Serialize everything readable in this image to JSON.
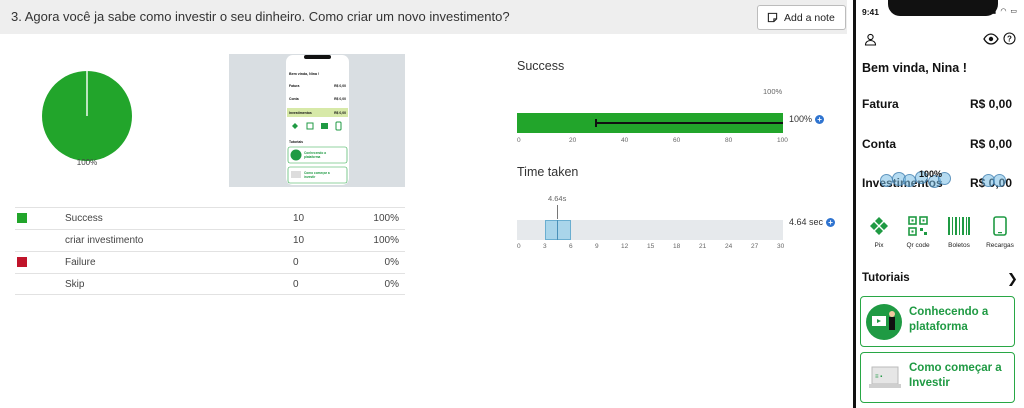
{
  "question": {
    "text": "3. Agora você ja sabe como investir o seu dinheiro. Como criar um novo investimento?",
    "note_button_label": "Add a note"
  },
  "pie": {
    "label": "100%",
    "color": "#22a52b"
  },
  "stats": {
    "rows": [
      {
        "name": "Success",
        "count": "10",
        "pct": "100%",
        "color": "#22a52b"
      },
      {
        "name": "criar investimento",
        "count": "10",
        "pct": "100%",
        "color": ""
      },
      {
        "name": "Failure",
        "count": "0",
        "pct": "0%",
        "color": "#c0142a"
      },
      {
        "name": "Skip",
        "count": "0",
        "pct": "0%",
        "color": ""
      }
    ]
  },
  "success_metric": {
    "title": "Success",
    "top_label": "100%",
    "value_label": "100%",
    "axis_ticks": [
      "0",
      "20",
      "40",
      "60",
      "80",
      "100"
    ],
    "fill_fraction": 1.0,
    "bar_color": "#22a52b"
  },
  "time_metric": {
    "title": "Time taken",
    "marker_label": "4.64s",
    "value_label": "4.64 sec",
    "axis_ticks": [
      "0",
      "3",
      "6",
      "9",
      "12",
      "15",
      "18",
      "21",
      "24",
      "27",
      "30"
    ],
    "box_color": "#a9d5ea"
  },
  "thumbnail": {
    "greeting": "Bem vinda, Nina !",
    "rows": [
      {
        "label": "Fatura",
        "value": "R$ 0,00"
      },
      {
        "label": "Conta",
        "value": "R$ 0,00"
      },
      {
        "label": "Investimentos",
        "value": "R$ 0,00"
      }
    ],
    "tutorials_label": "Tutoriais",
    "card1": "Conhecendo a plataforma",
    "card2": "Como começar a investir"
  },
  "phone": {
    "time": "9:41",
    "greeting": "Bem vinda, Nina !",
    "fatura_label": "Fatura",
    "fatura_value": "R$ 0,00",
    "conta_label": "Conta",
    "conta_value": "R$ 0,00",
    "invest_label": "Investimentos",
    "invest_value": "R$ 0,00",
    "heatmap_label": "100%",
    "shortcuts": [
      "Pix",
      "Qr code",
      "Boletos",
      "Recargas"
    ],
    "tutorials_title": "Tutoriais",
    "card1": "Conhecendo a plataforma",
    "card2": "Como começar a Investir",
    "accent": "#1f9a43"
  }
}
